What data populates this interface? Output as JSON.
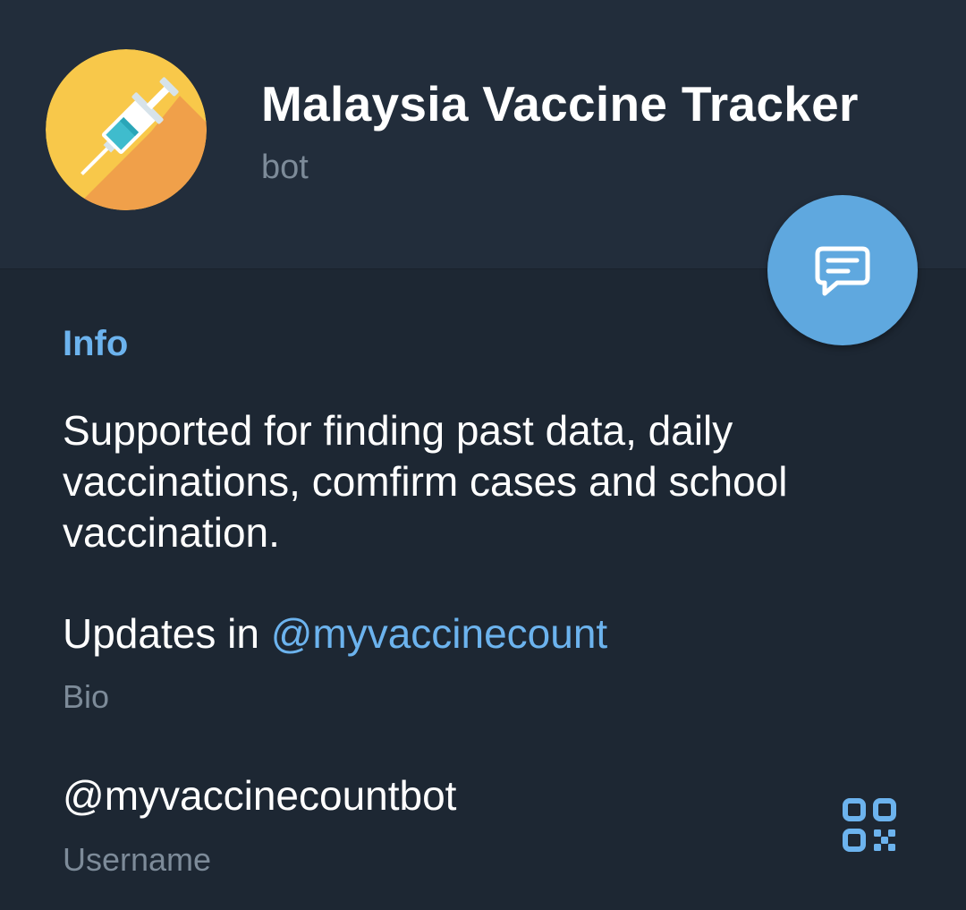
{
  "header": {
    "title": "Malaysia Vaccine Tracker",
    "subtitle": "bot",
    "avatar_icon": "syringe-icon",
    "avatar_colors": {
      "light": "#f8c84a",
      "shadow": "#f0a04a"
    }
  },
  "fab": {
    "icon": "message-icon",
    "color": "#5fa8df"
  },
  "info": {
    "section_title": "Info",
    "description": "Supported for finding past data, daily vaccinations, comfirm cases and school vaccination.",
    "bio_prefix": "Updates in ",
    "bio_link": "@myvaccinecount",
    "bio_caption": "Bio",
    "username": "@myvaccinecountbot",
    "username_caption": "Username",
    "qr_icon": "qr-code-icon"
  },
  "colors": {
    "background": "#1d2733",
    "header_background": "#222d3b",
    "accent": "#6cb3ee",
    "secondary_text": "#7d8b99"
  }
}
